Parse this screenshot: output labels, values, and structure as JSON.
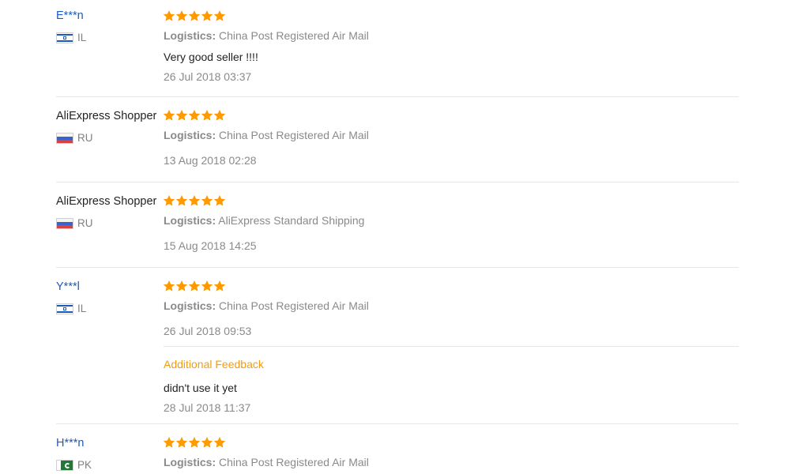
{
  "colors": {
    "star": "#ff9a00",
    "link": "#1c5bb9",
    "accent": "#f39c12",
    "muted": "#8a8a8a",
    "divider": "#e6e6e6"
  },
  "logistics_label": "Logistics:",
  "reviews": [
    {
      "user": "E***n",
      "country": "IL",
      "flag": "israel-flag-icon",
      "rating": 5,
      "logistics": "China Post Registered Air Mail",
      "comment": "Very good seller !!!!",
      "date": "26 Jul 2018 03:37"
    },
    {
      "user": "AliExpress Shopper",
      "country": "RU",
      "flag": "russia-flag-icon",
      "rating": 5,
      "logistics": "China Post Registered Air Mail",
      "comment": "",
      "date": "13 Aug 2018 02:28"
    },
    {
      "user": "AliExpress Shopper",
      "country": "RU",
      "flag": "russia-flag-icon",
      "rating": 5,
      "logistics": "AliExpress Standard Shipping",
      "comment": "",
      "date": "15 Aug 2018 14:25"
    },
    {
      "user": "Y***l",
      "country": "IL",
      "flag": "israel-flag-icon",
      "rating": 5,
      "logistics": "China Post Registered Air Mail",
      "comment": "",
      "date": "26 Jul 2018 09:53",
      "additional": {
        "heading": "Additional Feedback",
        "comment": "didn't use it yet",
        "date": "28 Jul 2018 11:37"
      }
    },
    {
      "user": "H***n",
      "country": "PK",
      "flag": "pakistan-flag-icon",
      "rating": 5,
      "logistics": "China Post Registered Air Mail",
      "comment": "",
      "date": ""
    }
  ]
}
